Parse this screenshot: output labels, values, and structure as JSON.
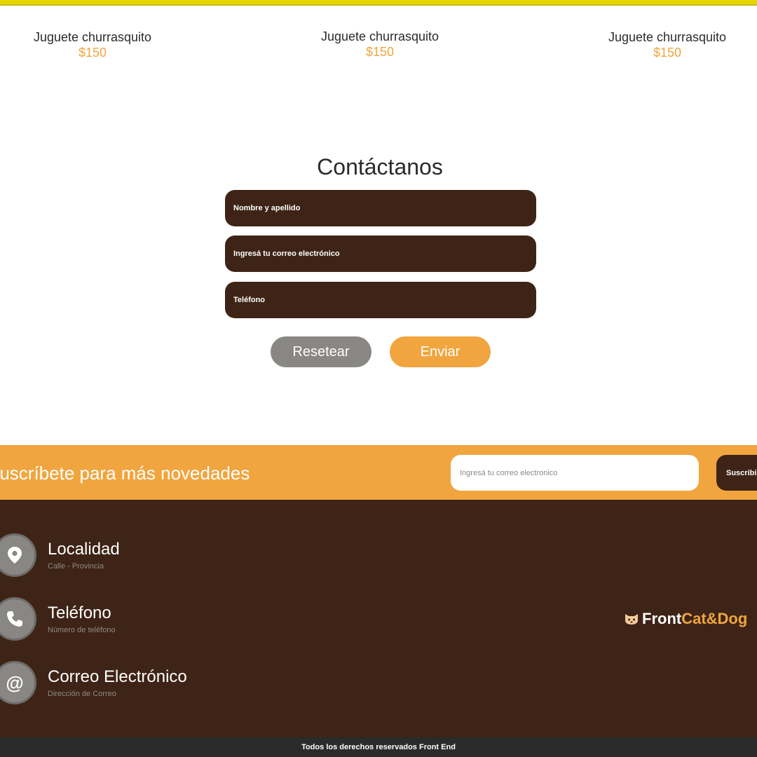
{
  "products": [
    {
      "name": "Juguete churrasquito",
      "price": "$150"
    },
    {
      "name": "Juguete churrasquito",
      "price": "$150"
    },
    {
      "name": "Juguete churrasquito",
      "price": "$150"
    }
  ],
  "contact": {
    "title": "Contáctanos",
    "name_placeholder": "Nombre y apellido",
    "email_placeholder": "Ingresá tu correo electrónico",
    "phone_placeholder": "Teléfono",
    "reset_label": "Resetear",
    "send_label": "Enviar"
  },
  "subscribe": {
    "title": "Suscríbete para más novedades",
    "input_placeholder": "Ingresá tu correo electronico",
    "button_label": "Suscribir"
  },
  "footer": {
    "info": [
      {
        "icon": "location-pin-icon",
        "title": "Localidad",
        "subtitle": "Calle - Provincia"
      },
      {
        "icon": "phone-icon",
        "title": "Teléfono",
        "subtitle": "Número de teléfono"
      },
      {
        "icon": "at-icon",
        "title": "Correo Electrónico",
        "subtitle": "Dirección de Correo"
      }
    ],
    "brand_part1": "Front",
    "brand_part2": "Cat&Dog",
    "at_symbol": "@",
    "copyright": "Todos los derechos reservados Front End"
  },
  "colors": {
    "accent_orange": "#f0a53e",
    "dark_brown": "#3e2416",
    "gray_button": "#898784",
    "top_bar_yellow": "#e6d600",
    "copyright_bg": "#2b2b2b"
  }
}
